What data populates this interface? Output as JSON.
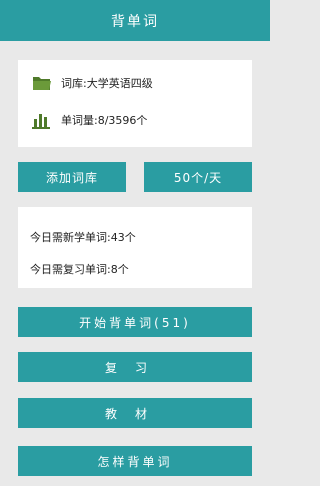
{
  "header": {
    "title": "背单词"
  },
  "library": {
    "name_text": "词库:大学英语四级",
    "count_text": "单词量:8/3596个"
  },
  "actions": {
    "add_library": "添加词库",
    "daily_rate": "50个/天"
  },
  "today": {
    "new_words": "今日需新学单词:43个",
    "review_words": "今日需复习单词:8个"
  },
  "menu": {
    "start": "开始背单词(51)",
    "review": "复习",
    "material": "教材",
    "how_to": "怎样背单词"
  },
  "colors": {
    "accent": "#2a9da2",
    "background": "#e9e9e9",
    "folder_icon": "#4f7a2a",
    "bar_icon": "#4f7a2a"
  },
  "icons": {
    "library": "folder-icon",
    "count": "bar-chart-icon"
  }
}
